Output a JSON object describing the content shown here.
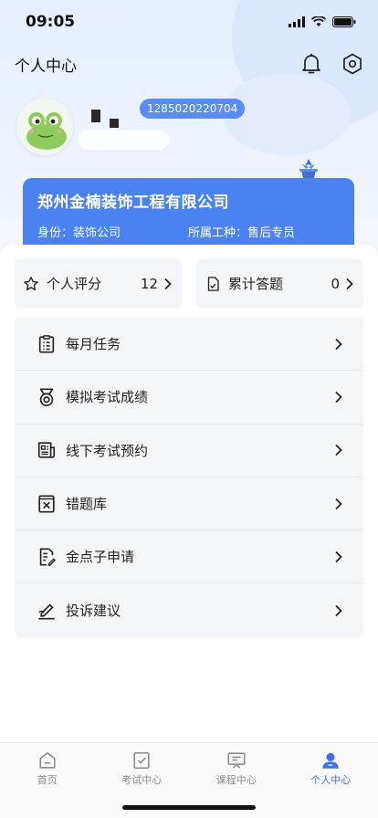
{
  "status_bar": {
    "time": "09:05"
  },
  "nav": {
    "title": "个人中心"
  },
  "profile": {
    "user_id": "1285020220704"
  },
  "company": {
    "name": "郑州金楠装饰工程有限公司",
    "identity": "身份：装饰公司",
    "job_type": "所属工种：售后专员"
  },
  "stats": [
    {
      "label": "个人评分",
      "value": "12",
      "icon": "star-icon"
    },
    {
      "label": "累计答题",
      "value": "0",
      "icon": "answer-doc-icon"
    }
  ],
  "menu": [
    {
      "label": "每月任务",
      "icon": "clipboard-list-icon"
    },
    {
      "label": "模拟考试成绩",
      "icon": "medal-icon"
    },
    {
      "label": "线下考试预约",
      "icon": "newspaper-icon"
    },
    {
      "label": "错题库",
      "icon": "wrong-book-icon"
    },
    {
      "label": "金点子申请",
      "icon": "doc-edit-icon"
    },
    {
      "label": "投诉建议",
      "icon": "pen-sign-icon"
    }
  ],
  "tabs": [
    {
      "label": "首页",
      "icon": "home-icon"
    },
    {
      "label": "考试中心",
      "icon": "exam-icon"
    },
    {
      "label": "课程中心",
      "icon": "course-icon"
    },
    {
      "label": "个人中心",
      "icon": "person-icon",
      "active": true
    }
  ],
  "colors": {
    "accent": "#4b82f2",
    "tab_active": "#3d6ff0",
    "tab_inactive": "#8a8a8a"
  }
}
